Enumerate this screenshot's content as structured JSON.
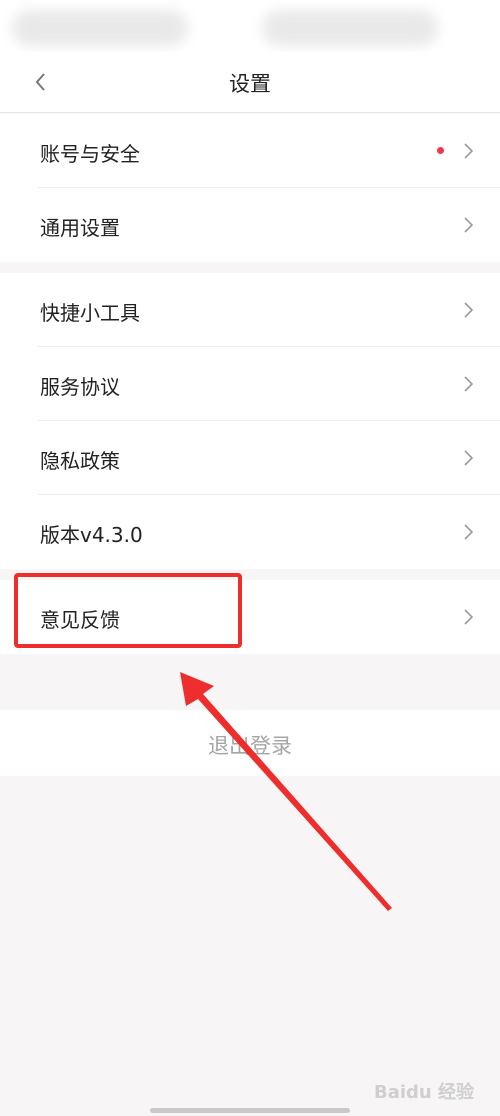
{
  "header": {
    "title": "设置"
  },
  "groups": [
    {
      "items": [
        {
          "label": "账号与安全",
          "badge": true
        },
        {
          "label": "通用设置"
        }
      ]
    },
    {
      "items": [
        {
          "label": "快捷小工具"
        },
        {
          "label": "服务协议"
        },
        {
          "label": "隐私政策"
        },
        {
          "label": "版本v4.3.0"
        }
      ]
    },
    {
      "items": [
        {
          "label": "意见反馈"
        }
      ]
    }
  ],
  "logout": {
    "label": "退出登录"
  },
  "watermark": "Baidu 经验",
  "colors": {
    "annotation_red": "#ee2d2d",
    "badge_red": "#f0364d",
    "background": "#f7f5f6"
  },
  "icons": {
    "back": "chevron-left-icon",
    "row": "chevron-right-icon"
  }
}
